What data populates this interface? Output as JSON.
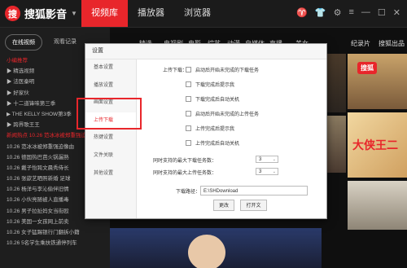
{
  "app": {
    "logo_mark": "搜",
    "name": "搜狐影音",
    "nav": [
      "视频库",
      "播放器",
      "浏览器"
    ]
  },
  "window_controls": [
    "♈",
    "👕",
    "⚙",
    "≡",
    "—",
    "☐",
    "✕"
  ],
  "sidebar": {
    "tabs": [
      "在线视频",
      "观看记录"
    ],
    "items": [
      {
        "text": "小编推荐",
        "red": true
      },
      {
        "text": "▶ 精选视频",
        "red": false
      },
      {
        "text": "▶ 法医秦明",
        "red": false
      },
      {
        "text": "▶ 好家伙",
        "red": false
      },
      {
        "text": "▶ 十二道锋味第三季",
        "red": false
      },
      {
        "text": "▶ THE KELLY SHOW第3季",
        "red": false
      },
      {
        "text": "▶ 跨界歌王王",
        "red": false
      },
      {
        "text": "新闻热点 10.26 范冰冰被郑重强迫",
        "red": true
      },
      {
        "text": "10.26 范冰冰被郑重强迫像由",
        "red": false
      },
      {
        "text": "10.26 德国热巴芭火锅漏熟",
        "red": false
      },
      {
        "text": "10.26 戴子怡跨文晨秀侍长",
        "red": false
      },
      {
        "text": "10.26 张歆艺晒照新婚 足球",
        "red": false
      },
      {
        "text": "10.26 杨洋与李沁偷伴旧情",
        "red": false
      },
      {
        "text": "10.26 小伙亮随被人直播毒",
        "red": false
      },
      {
        "text": "10.26 男子拉扯妈女当街殴",
        "red": false
      },
      {
        "text": "10.26 美国一女孩网上前卖",
        "red": false
      },
      {
        "text": "10.26 女子猛踢银行门翻拆小籍",
        "red": false
      },
      {
        "text": "10.26 5名学生乘扶铁通停列车",
        "red": false
      }
    ]
  },
  "content": {
    "categories": [
      "精选",
      "电视剧",
      "电影",
      "综艺",
      "动漫",
      "自媒体",
      "直播",
      "美女",
      "纪录片",
      "搜狐出品"
    ],
    "badge": "搜狐",
    "poster_title": "大侠王二"
  },
  "dialog": {
    "title": "设置",
    "nav": [
      "基本设置",
      "播放设置",
      "画面设置",
      "上传下载",
      "热键设置",
      "文件关联",
      "其他设置"
    ],
    "section_label": "上传下载：",
    "options": [
      "启动后开始未完成的下载任务",
      "下载完成后提示我",
      "下载完成后自动关机",
      "启动后开始未完成的上传任务",
      "上传完成后提示我",
      "上传完成后自动关机"
    ],
    "max_download_label": "同时支持的最大下载任务数：",
    "max_download_value": "3",
    "max_upload_label": "同时支持的最大上传任务数：",
    "max_upload_value": "3",
    "path_label": "下载路径：",
    "path_value": "E:\\SHDownload",
    "change_button": "更改",
    "open_button": "打开文"
  }
}
